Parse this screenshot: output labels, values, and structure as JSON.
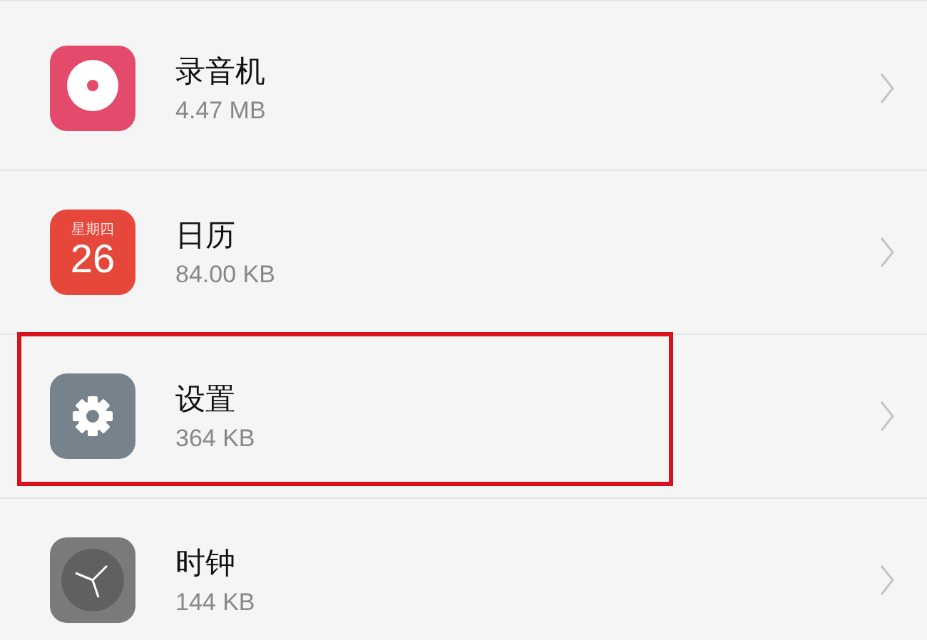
{
  "apps": [
    {
      "name": "录音机",
      "size": "4.47 MB",
      "kind": "recorder",
      "highlighted": false
    },
    {
      "name": "日历",
      "size": "84.00 KB",
      "kind": "calendar",
      "icon_weekday": "星期四",
      "icon_day": "26",
      "highlighted": false
    },
    {
      "name": "设置",
      "size": "364 KB",
      "kind": "settings",
      "highlighted": true
    },
    {
      "name": "时钟",
      "size": "144 KB",
      "kind": "clock",
      "highlighted": false
    }
  ]
}
